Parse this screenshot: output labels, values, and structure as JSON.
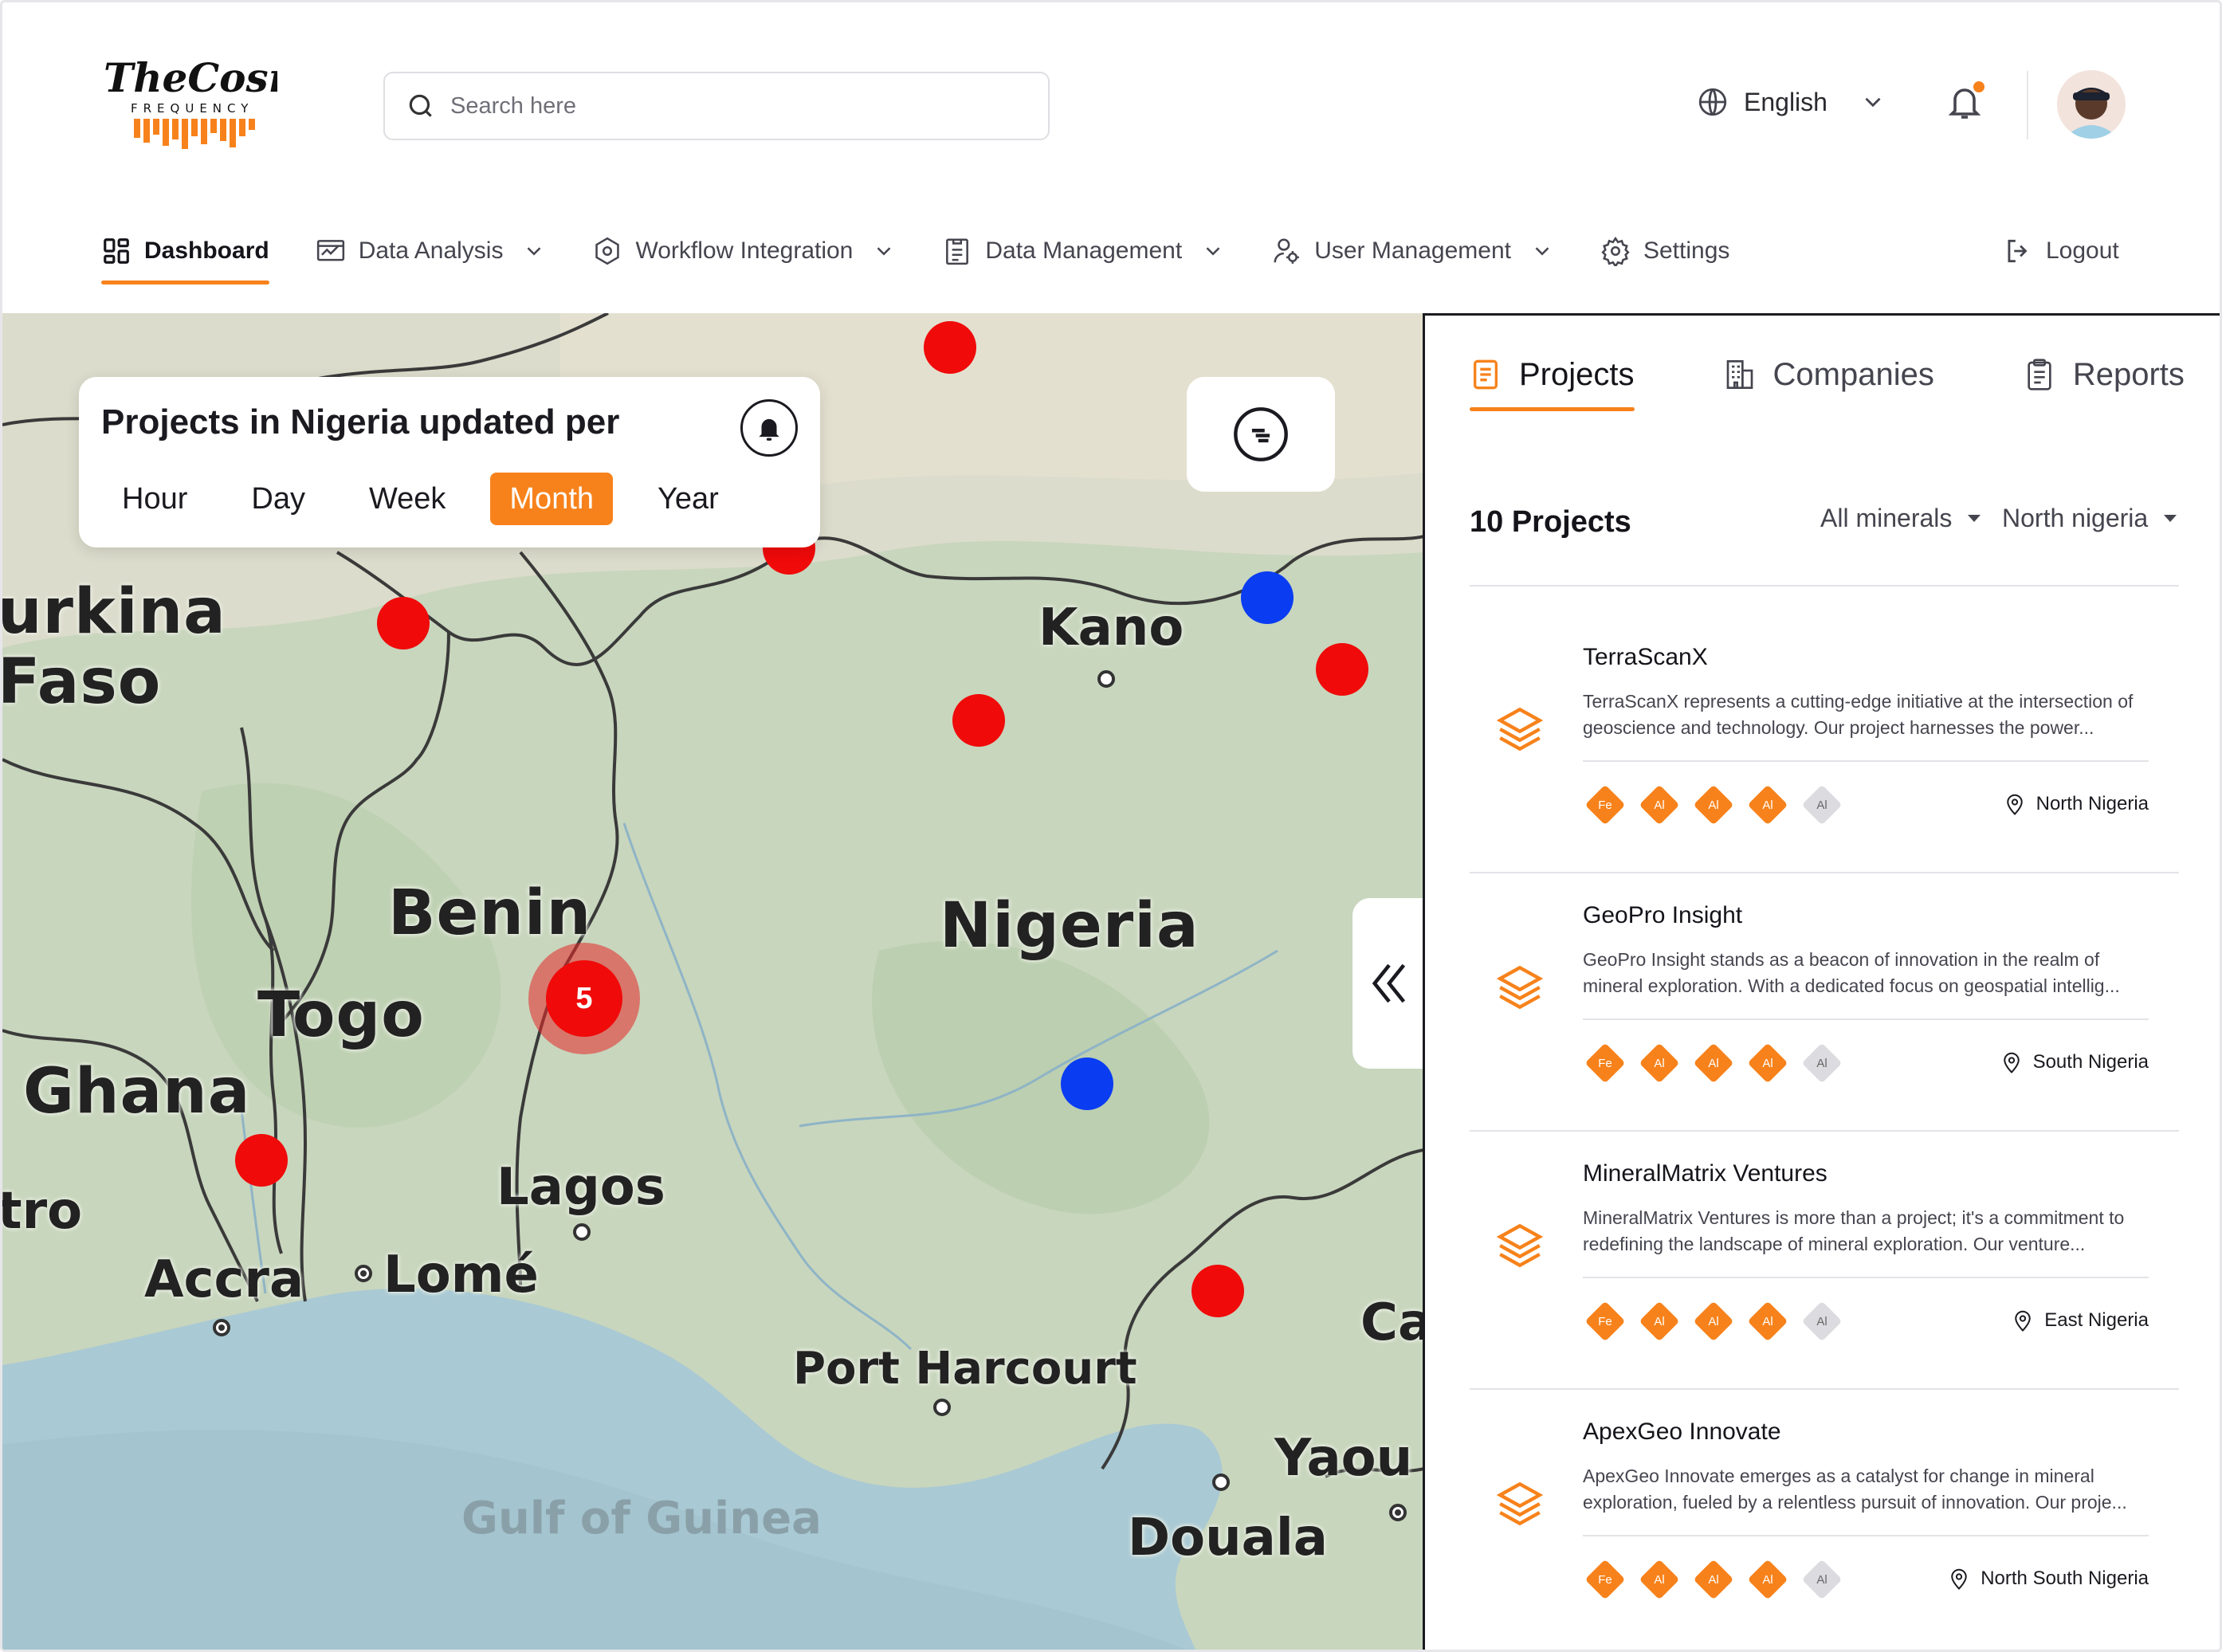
{
  "brand": {
    "logo_top": "TheCosmic",
    "logo_bottom": "FREQUENCY"
  },
  "search": {
    "placeholder": "Search here"
  },
  "language": {
    "label": "English"
  },
  "nav": {
    "items": [
      {
        "label": "Dashboard",
        "icon": "dashboard-icon"
      },
      {
        "label": "Data Analysis",
        "icon": "analysis-icon"
      },
      {
        "label": "Workflow Integration",
        "icon": "workflow-icon"
      },
      {
        "label": "Data Management",
        "icon": "data-management-icon"
      },
      {
        "label": "User Management",
        "icon": "user-management-icon"
      },
      {
        "label": "Settings",
        "icon": "gear-icon"
      }
    ],
    "logout": "Logout"
  },
  "map": {
    "card_title": "Projects in Nigeria updated per",
    "periods": [
      "Hour",
      "Day",
      "Week",
      "Month",
      "Year"
    ],
    "selected_period": "Month",
    "cluster_count": "5",
    "labels": {
      "burkina": "urkina",
      "faso": "Faso",
      "benin": "Benin",
      "togo": "Togo",
      "ghana": "Ghana",
      "nigeria": "Nigeria",
      "kano": "Kano",
      "lagos": "Lagos",
      "lome": "Lomé",
      "accra": "Accra",
      "port_harcourt": "Port Harcourt",
      "gulf": "Gulf of Guinea",
      "douala": "Douala",
      "yaounde": "Yaou",
      "ca": "Ca",
      "tro": "tro"
    },
    "colors": {
      "project_pin": "#f00a0a",
      "company_pin": "#0a3cf2",
      "accent": "#f7821b"
    }
  },
  "panel": {
    "tabs": [
      "Projects",
      "Companies",
      "Reports"
    ],
    "count_label": "10 Projects",
    "filter_minerals": "All minerals",
    "filter_region": "North nigeria",
    "projects": [
      {
        "name": "TerraScanX",
        "desc": "TerraScanX represents a cutting-edge initiative at the intersection of geoscience and technology. Our project harnesses the power...",
        "location": "North Nigeria",
        "chips": [
          "Fe",
          "Al",
          "Al",
          "Al",
          "Al"
        ]
      },
      {
        "name": "GeoPro Insight",
        "desc": "GeoPro Insight stands as a beacon of innovation in the realm of mineral exploration. With a dedicated focus on geospatial intellig...",
        "location": "South Nigeria",
        "chips": [
          "Fe",
          "Al",
          "Al",
          "Al",
          "Al"
        ]
      },
      {
        "name": "MineralMatrix Ventures",
        "desc": "MineralMatrix Ventures is more than a project; it's a commitment to redefining the landscape of mineral exploration. Our venture...",
        "location": "East Nigeria",
        "chips": [
          "Fe",
          "Al",
          "Al",
          "Al",
          "Al"
        ]
      },
      {
        "name": "ApexGeo Innovate",
        "desc": "ApexGeo Innovate emerges as a catalyst for change in mineral exploration, fueled by a relentless pursuit of innovation. Our proje...",
        "location": "North South Nigeria",
        "chips": [
          "Fe",
          "Al",
          "Al",
          "Al",
          "Al"
        ]
      }
    ]
  }
}
